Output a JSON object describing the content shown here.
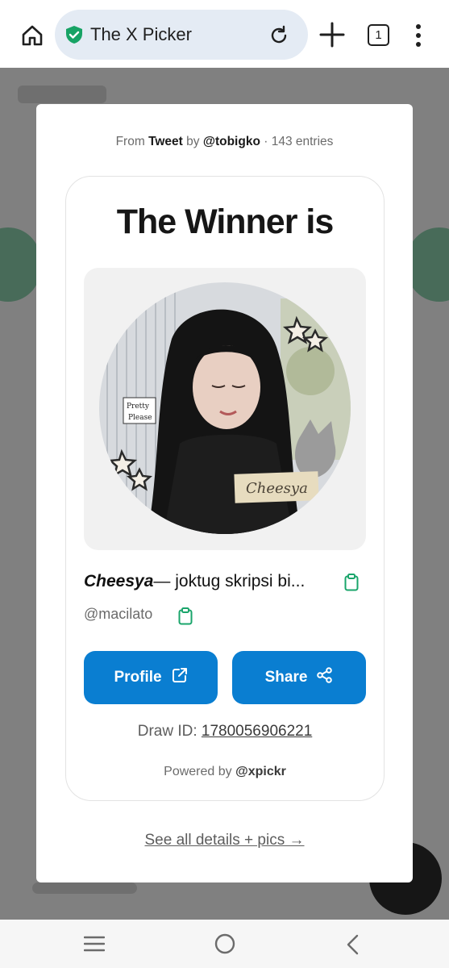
{
  "browser": {
    "url_text": "The X Picker",
    "tab_count": "1",
    "icons": [
      "home-icon",
      "shield-check-icon",
      "reload-icon",
      "plus-icon",
      "tabs-icon",
      "more-vert-icon"
    ]
  },
  "modal": {
    "from_prefix": "From",
    "from_source": "Tweet",
    "from_by": "by",
    "from_user": "@tobigko",
    "from_entries": "· 143 entries",
    "headline": "The Winner is",
    "winner_name_emph": "Cheesya",
    "winner_name_rest": "— joktug skripsi bi...",
    "winner_handle": "@macilato",
    "profile_label": "Profile",
    "share_label": "Share",
    "draw_id_label": "Draw ID:",
    "draw_id_value": "1780056906221",
    "powered_prefix": "Powered by",
    "powered_handle": "@xpickr",
    "see_all": "See all details + pics →",
    "photo_sticker_1": "Pretty",
    "photo_sticker_2": "Please",
    "photo_caption": "Cheesya"
  },
  "colors": {
    "accent_blue": "#0a7ed1",
    "copy_icon_green": "#1aa56b",
    "shield_green": "#17a365",
    "url_bar_bg": "#e4ebf4"
  }
}
